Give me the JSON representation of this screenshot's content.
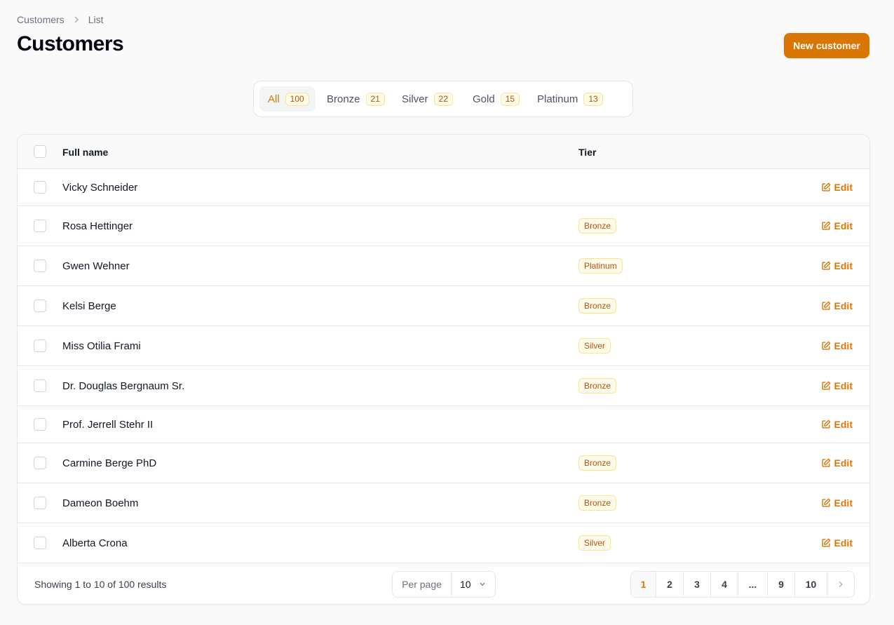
{
  "breadcrumb": {
    "items": [
      "Customers",
      "List"
    ]
  },
  "header": {
    "title": "Customers",
    "new_button": "New customer"
  },
  "tabs": [
    {
      "label": "All",
      "count": "100",
      "active": true
    },
    {
      "label": "Bronze",
      "count": "21"
    },
    {
      "label": "Silver",
      "count": "22"
    },
    {
      "label": "Gold",
      "count": "15"
    },
    {
      "label": "Platinum",
      "count": "13"
    }
  ],
  "table": {
    "columns": {
      "name": "Full name",
      "tier": "Tier"
    },
    "edit_label": "Edit",
    "rows": [
      {
        "name": "Vicky Schneider",
        "tier": ""
      },
      {
        "name": "Rosa Hettinger",
        "tier": "Bronze"
      },
      {
        "name": "Gwen Wehner",
        "tier": "Platinum"
      },
      {
        "name": "Kelsi Berge",
        "tier": "Bronze"
      },
      {
        "name": "Miss Otilia Frami",
        "tier": "Silver"
      },
      {
        "name": "Dr. Douglas Bergnaum Sr.",
        "tier": "Bronze"
      },
      {
        "name": "Prof. Jerrell Stehr II",
        "tier": ""
      },
      {
        "name": "Carmine Berge PhD",
        "tier": "Bronze"
      },
      {
        "name": "Dameon Boehm",
        "tier": "Bronze"
      },
      {
        "name": "Alberta Crona",
        "tier": "Silver"
      }
    ]
  },
  "footer": {
    "showing": "Showing 1 to 10 of 100 results",
    "per_page_label": "Per page",
    "per_page_value": "10",
    "pages": [
      "1",
      "2",
      "3",
      "4",
      "...",
      "9",
      "10"
    ],
    "current_page": "1"
  },
  "colors": {
    "accent": "#d97706",
    "badge_bg": "#fffbeb",
    "badge_border": "#fde68a"
  },
  "icons": {
    "breadcrumb_separator": "chevron-right-icon",
    "edit": "pencil-square-icon",
    "select": "chevron-down-icon",
    "next": "chevron-right-icon"
  }
}
